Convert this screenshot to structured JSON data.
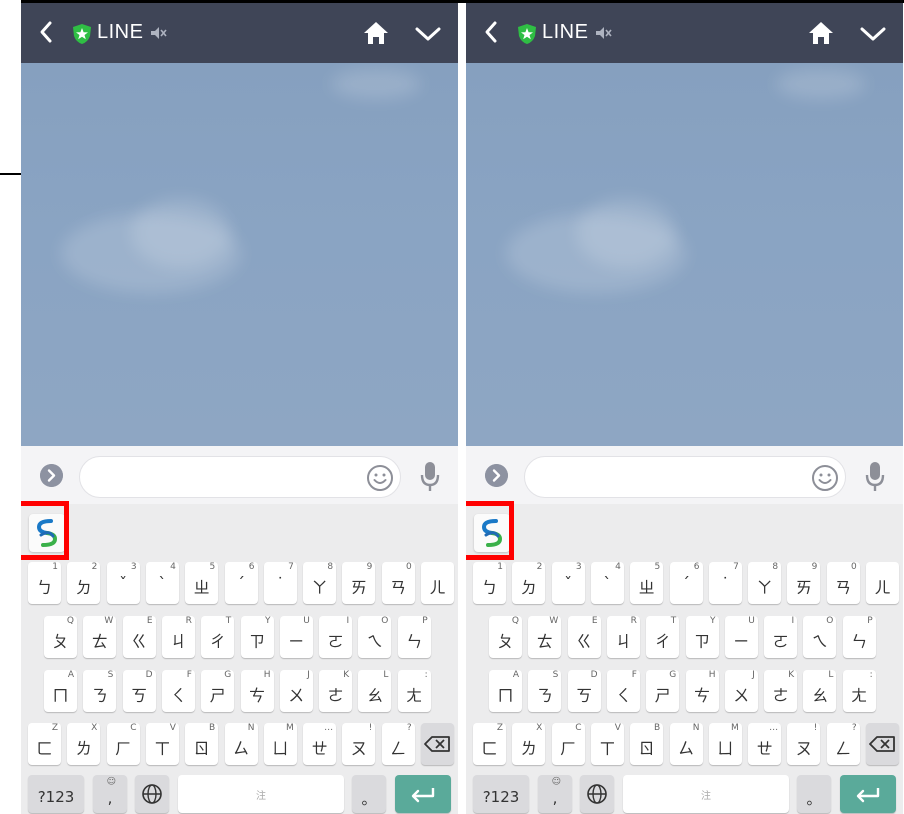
{
  "panels": [
    {
      "id": "left",
      "header": {
        "title": "LINE"
      },
      "keyboard": {
        "rows": [
          [
            {
              "k": "ㄅ",
              "h": "1"
            },
            {
              "k": "ㄉ",
              "h": "2"
            },
            {
              "k": "ˇ",
              "h": "3"
            },
            {
              "k": "ˋ",
              "h": "4"
            },
            {
              "k": "ㄓ",
              "h": "5"
            },
            {
              "k": "ˊ",
              "h": "6"
            },
            {
              "k": "˙",
              "h": "7"
            },
            {
              "k": "ㄚ",
              "h": "8"
            },
            {
              "k": "ㄞ",
              "h": "9"
            },
            {
              "k": "ㄢ",
              "h": "0"
            },
            {
              "k": "ㄦ",
              "h": ""
            }
          ],
          [
            {
              "k": "ㄆ",
              "h": "Q"
            },
            {
              "k": "ㄊ",
              "h": "W"
            },
            {
              "k": "ㄍ",
              "h": "E"
            },
            {
              "k": "ㄐ",
              "h": "R"
            },
            {
              "k": "ㄔ",
              "h": "T"
            },
            {
              "k": "ㄗ",
              "h": "Y"
            },
            {
              "k": "ㄧ",
              "h": "U"
            },
            {
              "k": "ㄛ",
              "h": "I"
            },
            {
              "k": "ㄟ",
              "h": "O"
            },
            {
              "k": "ㄣ",
              "h": "P"
            }
          ],
          [
            {
              "k": "ㄇ",
              "h": "A"
            },
            {
              "k": "ㄋ",
              "h": "S"
            },
            {
              "k": "ㄎ",
              "h": "D"
            },
            {
              "k": "ㄑ",
              "h": "F"
            },
            {
              "k": "ㄕ",
              "h": "G"
            },
            {
              "k": "ㄘ",
              "h": "H"
            },
            {
              "k": "ㄨ",
              "h": "J"
            },
            {
              "k": "ㄜ",
              "h": "K"
            },
            {
              "k": "ㄠ",
              "h": "L"
            },
            {
              "k": "ㄤ",
              "h": ":"
            }
          ],
          [
            {
              "k": "ㄈ",
              "h": "Z"
            },
            {
              "k": "ㄌ",
              "h": "X"
            },
            {
              "k": "ㄏ",
              "h": "C"
            },
            {
              "k": "ㄒ",
              "h": "V"
            },
            {
              "k": "ㄖ",
              "h": "B"
            },
            {
              "k": "ㄙ",
              "h": "N"
            },
            {
              "k": "ㄩ",
              "h": "M"
            },
            {
              "k": "ㄝ",
              "h": "…"
            },
            {
              "k": "ㄡ",
              "h": "!"
            },
            {
              "k": "ㄥ",
              "h": "?"
            }
          ]
        ],
        "bottom": {
          "symbols": "?123",
          "comma_hint": "☺",
          "comma": ",",
          "space": "注",
          "period": "。"
        }
      }
    },
    {
      "id": "right",
      "header": {
        "title": "LINE"
      },
      "keyboard": {
        "rows": [
          [
            {
              "k": "ㄅ",
              "h": "1"
            },
            {
              "k": "ㄉ",
              "h": "2"
            },
            {
              "k": "ˇ",
              "h": "3"
            },
            {
              "k": "ˋ",
              "h": "4"
            },
            {
              "k": "ㄓ",
              "h": "5"
            },
            {
              "k": "ˊ",
              "h": "6"
            },
            {
              "k": "˙",
              "h": "7"
            },
            {
              "k": "ㄚ",
              "h": "8"
            },
            {
              "k": "ㄞ",
              "h": "9"
            },
            {
              "k": "ㄢ",
              "h": "0"
            },
            {
              "k": "ㄦ",
              "h": ""
            }
          ],
          [
            {
              "k": "ㄆ",
              "h": "Q"
            },
            {
              "k": "ㄊ",
              "h": "W"
            },
            {
              "k": "ㄍ",
              "h": "E"
            },
            {
              "k": "ㄐ",
              "h": "R"
            },
            {
              "k": "ㄔ",
              "h": "T"
            },
            {
              "k": "ㄗ",
              "h": "Y"
            },
            {
              "k": "ㄧ",
              "h": "U"
            },
            {
              "k": "ㄛ",
              "h": "I"
            },
            {
              "k": "ㄟ",
              "h": "O"
            },
            {
              "k": "ㄣ",
              "h": "P"
            }
          ],
          [
            {
              "k": "ㄇ",
              "h": "A"
            },
            {
              "k": "ㄋ",
              "h": "S"
            },
            {
              "k": "ㄎ",
              "h": "D"
            },
            {
              "k": "ㄑ",
              "h": "F"
            },
            {
              "k": "ㄕ",
              "h": "G"
            },
            {
              "k": "ㄘ",
              "h": "H"
            },
            {
              "k": "ㄨ",
              "h": "J"
            },
            {
              "k": "ㄜ",
              "h": "K"
            },
            {
              "k": "ㄠ",
              "h": "L"
            },
            {
              "k": "ㄤ",
              "h": ":"
            }
          ],
          [
            {
              "k": "ㄈ",
              "h": "Z"
            },
            {
              "k": "ㄌ",
              "h": "X"
            },
            {
              "k": "ㄏ",
              "h": "C"
            },
            {
              "k": "ㄒ",
              "h": "V"
            },
            {
              "k": "ㄖ",
              "h": "B"
            },
            {
              "k": "ㄙ",
              "h": "N"
            },
            {
              "k": "ㄩ",
              "h": "M"
            },
            {
              "k": "ㄝ",
              "h": "…"
            },
            {
              "k": "ㄡ",
              "h": "!"
            },
            {
              "k": "ㄥ",
              "h": "?"
            }
          ]
        ],
        "bottom": {
          "symbols": "?123",
          "comma_hint": "☺",
          "comma": ",",
          "space": "注",
          "period": "。"
        }
      }
    }
  ],
  "colors": {
    "header_bg": "#3f4557",
    "chat_bg": "#8aa4c3",
    "shield_green": "#2fbe44",
    "enter_key": "#5aaa9a",
    "highlight": "#ff0000"
  },
  "icons": [
    "back-arrow-icon",
    "official-shield-icon",
    "mute-icon",
    "home-icon",
    "chevron-down-icon",
    "more-icon",
    "emoji-icon",
    "mic-icon",
    "app-logo-icon",
    "backspace-icon",
    "globe-icon",
    "enter-icon"
  ]
}
